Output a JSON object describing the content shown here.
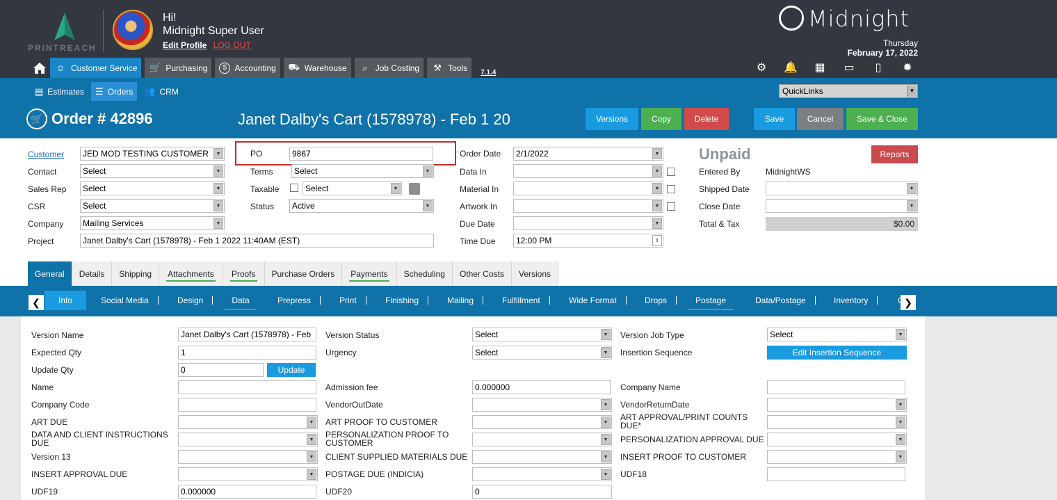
{
  "header": {
    "logo_text": "PRINTREACH",
    "greeting": "Hi!",
    "user_name": "Midnight Super User",
    "edit_profile": "Edit Profile",
    "logout": "LOG OUT",
    "brand": "Midnight",
    "day": "Thursday",
    "date": "February 17, 2022",
    "version": "7.1.4"
  },
  "main_nav": [
    {
      "label": "Customer Service",
      "icon": "customer-service-icon",
      "active": true
    },
    {
      "label": "Purchasing",
      "icon": "cart-icon",
      "active": false
    },
    {
      "label": "Accounting",
      "icon": "dollar-icon",
      "active": false
    },
    {
      "label": "Warehouse",
      "icon": "truck-icon",
      "active": false
    },
    {
      "label": "Job Costing",
      "icon": "search-icon",
      "active": false
    },
    {
      "label": "Tools",
      "icon": "tools-icon",
      "active": false
    }
  ],
  "top_icons": [
    "network-icon",
    "bell-icon",
    "calendar-icon",
    "monitor-icon",
    "document-icon",
    "gear-icon"
  ],
  "sub_nav": [
    {
      "label": "Estimates",
      "icon": "calculator-icon",
      "active": false
    },
    {
      "label": "Orders",
      "icon": "list-icon",
      "active": true
    },
    {
      "label": "CRM",
      "icon": "people-icon",
      "active": false
    }
  ],
  "quicklinks": "QuickLinks",
  "order": {
    "number": "Order # 42896",
    "cart_name": "Janet Dalby's Cart (1578978) - Feb 1 20"
  },
  "actions": {
    "versions": "Versions",
    "copy": "Copy",
    "delete": "Delete",
    "save": "Save",
    "cancel": "Cancel",
    "save_close": "Save & Close"
  },
  "form": {
    "customer_label": "Customer",
    "customer_value": "JED MOD TESTING CUSTOMER",
    "contact_label": "Contact",
    "contact_value": "Select",
    "sales_rep_label": "Sales Rep",
    "sales_rep_value": "Select",
    "csr_label": "CSR",
    "csr_value": "Select",
    "company_label": "Company",
    "company_value": "Mailing Services",
    "project_label": "Project",
    "project_value": "Janet Dalby's Cart (1578978) - Feb  1 2022 11:40AM (EST)",
    "po_label": "PO",
    "po_value": "9867",
    "terms_label": "Terms",
    "terms_value": "Select",
    "taxable_label": "Taxable",
    "taxable_value": "Select",
    "status_label": "Status",
    "status_value": "Active",
    "order_date_label": "Order Date",
    "order_date_value": "2/1/2022",
    "data_in_label": "Data In",
    "material_in_label": "Material In",
    "artwork_in_label": "Artwork In",
    "due_date_label": "Due Date",
    "time_due_label": "Time Due",
    "time_due_value": "12:00 PM",
    "payment_status": "Unpaid",
    "reports": "Reports",
    "entered_by_label": "Entered By",
    "entered_by_value": "MidnightWS",
    "shipped_date_label": "Shipped Date",
    "close_date_label": "Close Date",
    "total_tax_label": "Total & Tax",
    "total_tax_value": "$0.00"
  },
  "tabs_primary": [
    {
      "label": "General",
      "active": true,
      "underline": false
    },
    {
      "label": "Details",
      "active": false,
      "underline": false
    },
    {
      "label": "Shipping",
      "active": false,
      "underline": false
    },
    {
      "label": "Attachments",
      "active": false,
      "underline": true
    },
    {
      "label": "Proofs",
      "active": false,
      "underline": true
    },
    {
      "label": "Purchase Orders",
      "active": false,
      "underline": false
    },
    {
      "label": "Payments",
      "active": false,
      "underline": true
    },
    {
      "label": "Scheduling",
      "active": false,
      "underline": false
    },
    {
      "label": "Other Costs",
      "active": false,
      "underline": false
    },
    {
      "label": "Versions",
      "active": false,
      "underline": false
    }
  ],
  "tabs_secondary": [
    {
      "label": "Info",
      "active": true,
      "underline": false
    },
    {
      "label": "Social Media",
      "active": false,
      "underline": false
    },
    {
      "label": "Design",
      "active": false,
      "underline": false
    },
    {
      "label": "Data",
      "active": false,
      "underline": true
    },
    {
      "label": "Prepress",
      "active": false,
      "underline": false
    },
    {
      "label": "Print",
      "active": false,
      "underline": false
    },
    {
      "label": "Finishing",
      "active": false,
      "underline": false
    },
    {
      "label": "Mailing",
      "active": false,
      "underline": false
    },
    {
      "label": "Fulfillment",
      "active": false,
      "underline": false
    },
    {
      "label": "Wide Format",
      "active": false,
      "underline": false
    },
    {
      "label": "Drops",
      "active": false,
      "underline": false
    },
    {
      "label": "Postage",
      "active": false,
      "underline": true
    },
    {
      "label": "Data/Postage",
      "active": false,
      "underline": false
    },
    {
      "label": "Inventory",
      "active": false,
      "underline": false
    },
    {
      "label": "C",
      "active": false,
      "underline": false
    }
  ],
  "info": {
    "version_name_label": "Version Name",
    "version_name_value": "Janet Dalby's Cart (1578978) - Feb",
    "expected_qty_label": "Expected Qty",
    "expected_qty_value": "1",
    "update_qty_label": "Update Qty",
    "update_qty_value": "0",
    "update_button": "Update",
    "name_label": "Name",
    "company_code_label": "Company Code",
    "art_due_label": "ART DUE",
    "data_client_label": "DATA AND CLIENT INSTRUCTIONS DUE",
    "version13_label": "Version 13",
    "insert_approval_label": "INSERT APPROVAL DUE",
    "udf19_label": "UDF19",
    "udf19_value": "0.000000",
    "version_status_label": "Version Status",
    "version_status_value": "Select",
    "urgency_label": "Urgency",
    "urgency_value": "Select",
    "admission_fee_label": "Admission fee",
    "admission_fee_value": "0.000000",
    "vendor_out_label": "VendorOutDate",
    "art_proof_label": "ART PROOF TO CUSTOMER",
    "personalization_proof_label": "PERSONALIZATION PROOF TO CUSTOMER",
    "client_supplied_label": "CLIENT SUPPLIED MATERIALS DUE",
    "postage_due_label": "POSTAGE DUE (INDICIA)",
    "udf20_label": "UDF20",
    "udf20_value": "0",
    "version_job_type_label": "Version Job Type",
    "version_job_type_value": "Select",
    "insertion_sequence_label": "Insertion Sequence",
    "edit_insertion_button": "Edit Insertion Sequence",
    "company_name_label": "Company Name",
    "vendor_return_label": "VendorReturnDate",
    "art_approval_label": "ART APPROVAL/PRINT COUNTS DUE*",
    "personalization_approval_label": "PERSONALIZATION APPROVAL DUE",
    "insert_proof_label": "INSERT PROOF TO CUSTOMER",
    "udf18_label": "UDF18"
  }
}
